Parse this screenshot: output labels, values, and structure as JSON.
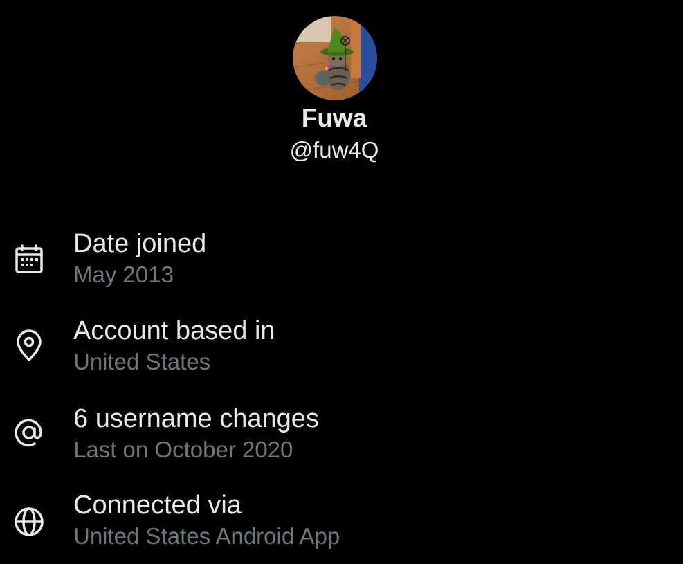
{
  "profile": {
    "display_name": "Fuwa",
    "handle": "@fuw4Q",
    "avatar_description": "cat-with-green-witch-hat"
  },
  "info_items": [
    {
      "icon": "calendar-icon",
      "title": "Date joined",
      "value": "May 2013"
    },
    {
      "icon": "location-pin-icon",
      "title": "Account based in",
      "value": "United States"
    },
    {
      "icon": "at-sign-icon",
      "title": "6 username changes",
      "value": "Last on October 2020"
    },
    {
      "icon": "globe-icon",
      "title": "Connected via",
      "value": "United States Android App"
    }
  ],
  "colors": {
    "background": "#000000",
    "primary_text": "#e7e9ea",
    "secondary_text": "#71767b"
  }
}
